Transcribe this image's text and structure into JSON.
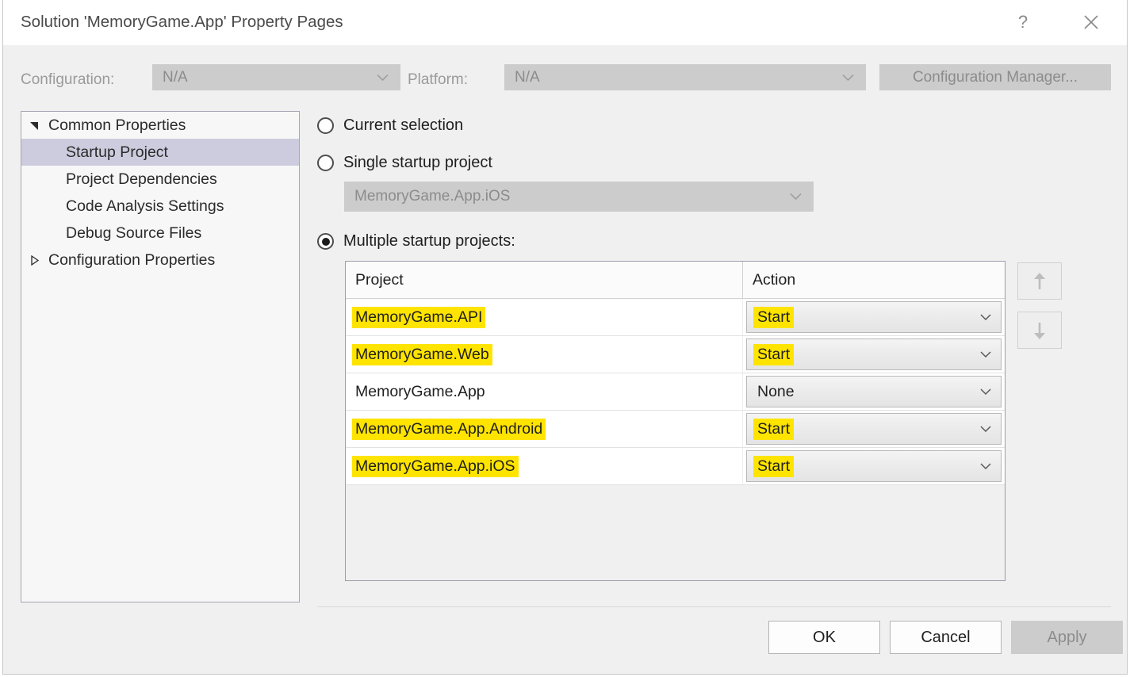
{
  "window": {
    "title": "Solution 'MemoryGame.App' Property Pages",
    "help_icon": "question-mark-icon",
    "close_icon": "close-icon"
  },
  "config_bar": {
    "configuration_label": "Configuration:",
    "configuration_value": "N/A",
    "platform_label": "Platform:",
    "platform_value": "N/A",
    "configuration_manager_label": "Configuration Manager...",
    "enabled": false
  },
  "tree": {
    "items": [
      {
        "label": "Common Properties",
        "level": 0,
        "expander": "triangle-down-filled",
        "selected": false
      },
      {
        "label": "Startup Project",
        "level": 1,
        "expander": "",
        "selected": true
      },
      {
        "label": "Project Dependencies",
        "level": 1,
        "expander": "",
        "selected": false
      },
      {
        "label": "Code Analysis Settings",
        "level": 1,
        "expander": "",
        "selected": false
      },
      {
        "label": "Debug Source Files",
        "level": 1,
        "expander": "",
        "selected": false
      },
      {
        "label": "Configuration Properties",
        "level": 0,
        "expander": "triangle-right-hollow",
        "selected": false
      }
    ]
  },
  "startup_options": {
    "current_selection_label": "Current selection",
    "current_selection_checked": false,
    "single_startup_label": "Single startup project",
    "single_startup_checked": false,
    "single_startup_value": "MemoryGame.App.iOS",
    "single_startup_enabled": false,
    "multiple_startup_label": "Multiple startup projects:",
    "multiple_startup_checked": true
  },
  "grid": {
    "columns": [
      "Project",
      "Action"
    ],
    "rows": [
      {
        "project": "MemoryGame.API",
        "action": "Start",
        "project_highlighted": true,
        "action_highlighted": true
      },
      {
        "project": "MemoryGame.Web",
        "action": "Start",
        "project_highlighted": true,
        "action_highlighted": true
      },
      {
        "project": "MemoryGame.App",
        "action": "None",
        "project_highlighted": false,
        "action_highlighted": false
      },
      {
        "project": "MemoryGame.App.Android",
        "action": "Start",
        "project_highlighted": true,
        "action_highlighted": true
      },
      {
        "project": "MemoryGame.App.iOS",
        "action": "Start",
        "project_highlighted": true,
        "action_highlighted": true
      }
    ]
  },
  "reorder": {
    "move_up_icon": "arrow-up-icon",
    "move_down_icon": "arrow-down-icon",
    "enabled": false
  },
  "footer": {
    "ok_label": "OK",
    "cancel_label": "Cancel",
    "apply_label": "Apply",
    "apply_enabled": false
  },
  "colors": {
    "highlight_yellow": "#ffe400",
    "tree_selection": "#ccccde",
    "dialog_background": "#f0f0f0"
  }
}
